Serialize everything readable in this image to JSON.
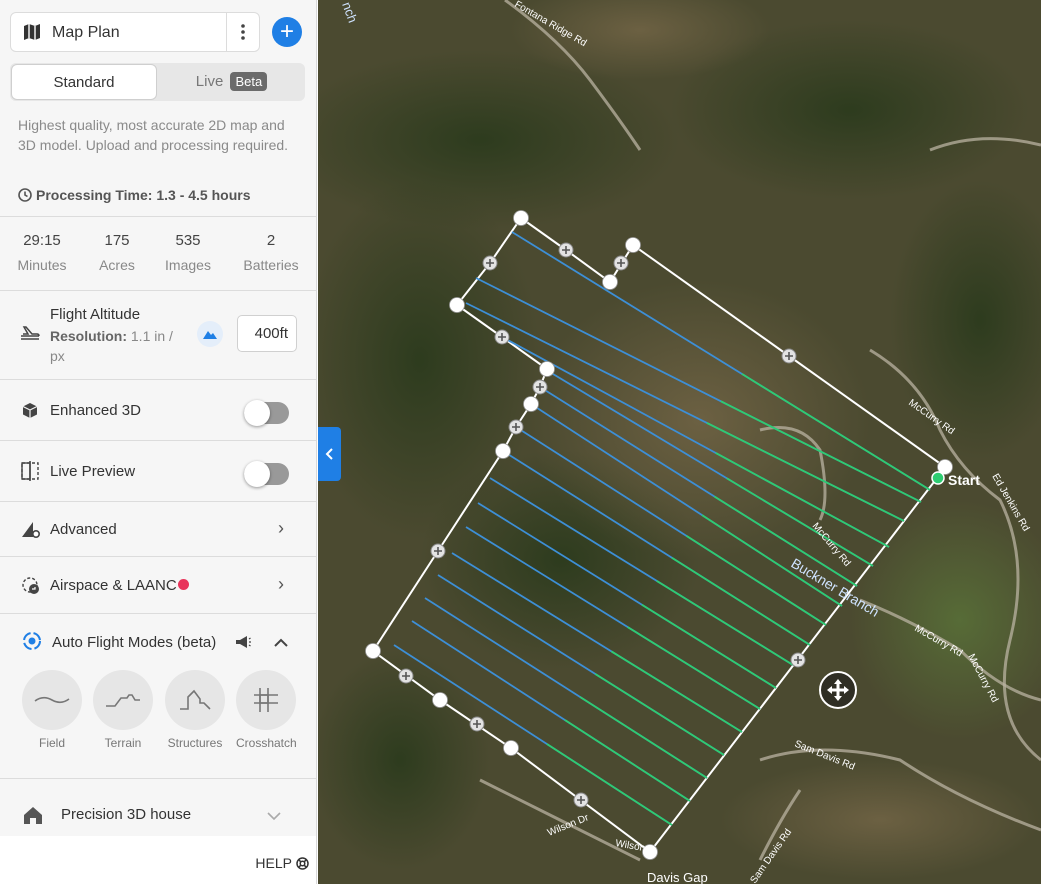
{
  "header": {
    "title": "Map Plan",
    "add_label": "+"
  },
  "mode_tabs": [
    {
      "label": "Standard",
      "active": true
    },
    {
      "label": "Live",
      "badge": "Beta",
      "active": false
    }
  ],
  "description": "Highest quality, most accurate 2D map and 3D model. Upload and processing required.",
  "processing_time": "Processing Time: 1.3 - 4.5 hours",
  "stats": [
    {
      "value": "29:15",
      "label": "Minutes"
    },
    {
      "value": "175",
      "label": "Acres"
    },
    {
      "value": "535",
      "label": "Images"
    },
    {
      "value": "2",
      "label": "Batteries"
    }
  ],
  "altitude": {
    "label": "Flight Altitude",
    "resolution_label": "Resolution:",
    "resolution_value": "1.1 in / px",
    "value": "400ft"
  },
  "settings": {
    "enhanced_3d": {
      "label": "Enhanced 3D",
      "enabled": false
    },
    "live_preview": {
      "label": "Live Preview",
      "enabled": false
    },
    "advanced": {
      "label": "Advanced"
    },
    "airspace": {
      "label": "Airspace & LAANC"
    },
    "auto_flight": {
      "label": "Auto Flight Modes (beta)"
    }
  },
  "flight_modes": [
    {
      "label": "Field"
    },
    {
      "label": "Terrain"
    },
    {
      "label": "Structures"
    },
    {
      "label": "Crosshatch"
    }
  ],
  "preset": {
    "label": "Precision 3D house"
  },
  "help": {
    "label": "HELP"
  },
  "map": {
    "start_label": "Start",
    "roads": [
      "Fontana Ridge Rd",
      "McCurry Rd",
      "McCurry Rd",
      "McCurry Rd",
      "Ed Jenkins Rd",
      "McCurry Rd",
      "Sam Davis Rd",
      "Sam Davis Rd",
      "Wilson Dr",
      "Wilson",
      "Davis Gap",
      "Buckner Branch",
      "nch"
    ]
  },
  "colors": {
    "accent": "#1f7fe5",
    "alert_dot": "#e8345b",
    "path_green": "#2ecc71",
    "path_blue": "#3d8fd6",
    "boundary": "#ffffff",
    "start_dot": "#2ecc71"
  }
}
